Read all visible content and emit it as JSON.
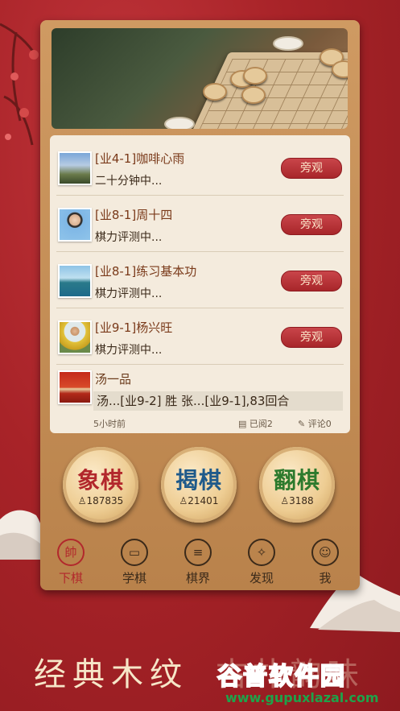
{
  "games": [
    {
      "name": "[业4-1]咖啡心雨",
      "status": "二十分钟中...",
      "action": "旁观",
      "avatar": "mountain-landscape-avatar"
    },
    {
      "name": "[业8-1]周十四",
      "status": "棋力评测中...",
      "action": "旁观",
      "avatar": "boy-portrait-avatar"
    },
    {
      "name": "[业8-1]练习基本功",
      "status": "棋力评测中...",
      "action": "旁观",
      "avatar": "sea-landscape-avatar"
    },
    {
      "name": "[业9-1]杨兴旺",
      "status": "棋力评测中...",
      "action": "旁观",
      "avatar": "man-portrait-avatar"
    }
  ],
  "feed": {
    "name": "汤一品",
    "content": "汤...[业9-2] 胜 张...[业9-1],83回合",
    "time": "5小时前",
    "read": "已阅2",
    "comments": "评论0"
  },
  "modes": [
    {
      "title": "象棋",
      "count": "187835",
      "color": "#b2282c"
    },
    {
      "title": "揭棋",
      "count": "21401",
      "color": "#1f5a8a"
    },
    {
      "title": "翻棋",
      "count": "3188",
      "color": "#2d7a2d"
    }
  ],
  "nav": [
    {
      "label": "下棋",
      "icon": "帥",
      "active": true
    },
    {
      "label": "学棋",
      "icon": "book-icon"
    },
    {
      "label": "棋界",
      "icon": "message-icon"
    },
    {
      "label": "发现",
      "icon": "compass-icon"
    },
    {
      "label": "我",
      "icon": "user-icon"
    }
  ],
  "slogan": "经典木纹",
  "slogan_faded": "古朴韵味",
  "watermark": {
    "title": "谷普软件园",
    "url": "www.gupuxlazal.com"
  },
  "colors": {
    "accent": "#b2282c",
    "bg": "#a8262a"
  }
}
